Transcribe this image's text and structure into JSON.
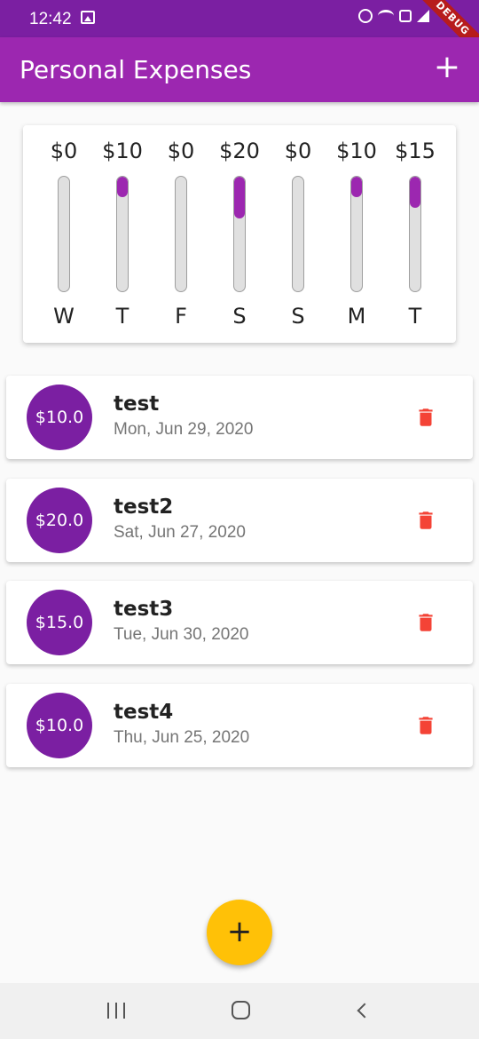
{
  "status_bar": {
    "time": "12:42",
    "debug_label": "DEBUG"
  },
  "app_bar": {
    "title": "Personal Expenses",
    "add_label": "+"
  },
  "colors": {
    "primary": "#9c27b0",
    "primary_dark": "#7b1fa2",
    "accent": "#ffc107",
    "delete": "#f44336"
  },
  "chart": {
    "bars": [
      {
        "day": "W",
        "amount": "$0",
        "pct": 0
      },
      {
        "day": "T",
        "amount": "$10",
        "pct": 0.1818
      },
      {
        "day": "F",
        "amount": "$0",
        "pct": 0
      },
      {
        "day": "S",
        "amount": "$20",
        "pct": 0.3636
      },
      {
        "day": "S",
        "amount": "$0",
        "pct": 0
      },
      {
        "day": "M",
        "amount": "$10",
        "pct": 0.1818
      },
      {
        "day": "T",
        "amount": "$15",
        "pct": 0.2727
      }
    ]
  },
  "transactions": [
    {
      "amount": "$10.0",
      "title": "test",
      "date": "Mon, Jun 29, 2020"
    },
    {
      "amount": "$20.0",
      "title": "test2",
      "date": "Sat, Jun 27, 2020"
    },
    {
      "amount": "$15.0",
      "title": "test3",
      "date": "Tue, Jun 30, 2020"
    },
    {
      "amount": "$10.0",
      "title": "test4",
      "date": "Thu, Jun 25, 2020"
    }
  ],
  "fab": {
    "label": "+"
  },
  "icons": {
    "delete": "trash-icon",
    "add": "plus-icon",
    "nav_recent": "recent-apps-icon",
    "nav_home": "home-icon",
    "nav_back": "back-icon"
  }
}
